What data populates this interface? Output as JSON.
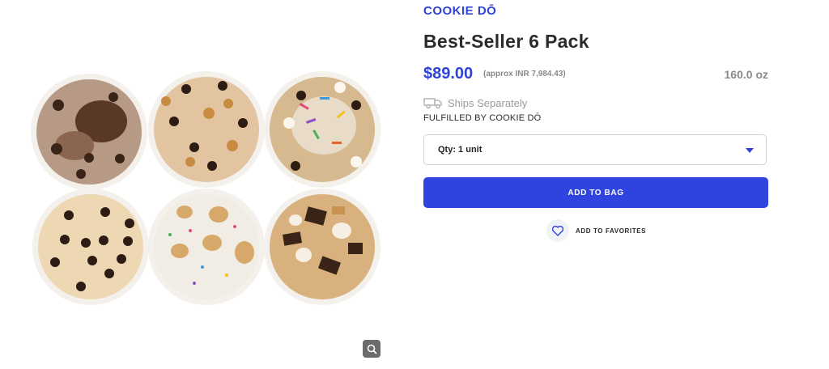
{
  "product": {
    "brand": "COOKIE DŌ",
    "title": "Best-Seller 6 Pack",
    "price": "$89.00",
    "price_approx": "(approx INR 7,984.43)",
    "weight": "160.0 oz",
    "shipping_note": "Ships Separately",
    "fulfilled_by": "FULFILLED BY COOKIE DŌ"
  },
  "quantity_select": {
    "selected": "Qty: 1 unit"
  },
  "actions": {
    "add_to_bag": "ADD TO BAG",
    "add_to_favorites": "ADD TO FAVORITES"
  },
  "gallery": {
    "image_subject": "six tubs of cookie dough",
    "zoom_icon": "magnifier-icon"
  },
  "colors": {
    "accent": "#2f44de",
    "brand_text": "#2f44d6",
    "muted_text": "#8a8a8a"
  }
}
